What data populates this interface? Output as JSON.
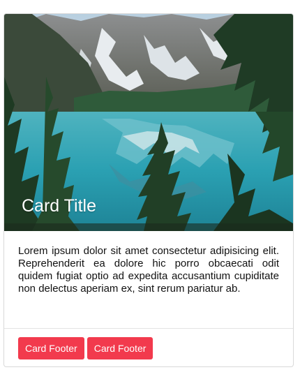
{
  "card": {
    "title": "Card Title",
    "image_icon": "mountain-lake-photo",
    "body_text": "Lorem ipsum dolor sit amet consectetur adipisicing elit. Reprehenderit ea dolore hic porro obcaecati odit quidem fugiat optio ad expedita accusantium cupiditate non delectus aperiam ex, sint rerum pariatur ab.",
    "footer_buttons": [
      {
        "label": "Card Footer"
      },
      {
        "label": "Card Footer"
      }
    ]
  },
  "colors": {
    "button_bg": "#f23a4d",
    "button_text": "#ffffff",
    "title_text": "#ffffff",
    "border": "#d9d9d9"
  }
}
